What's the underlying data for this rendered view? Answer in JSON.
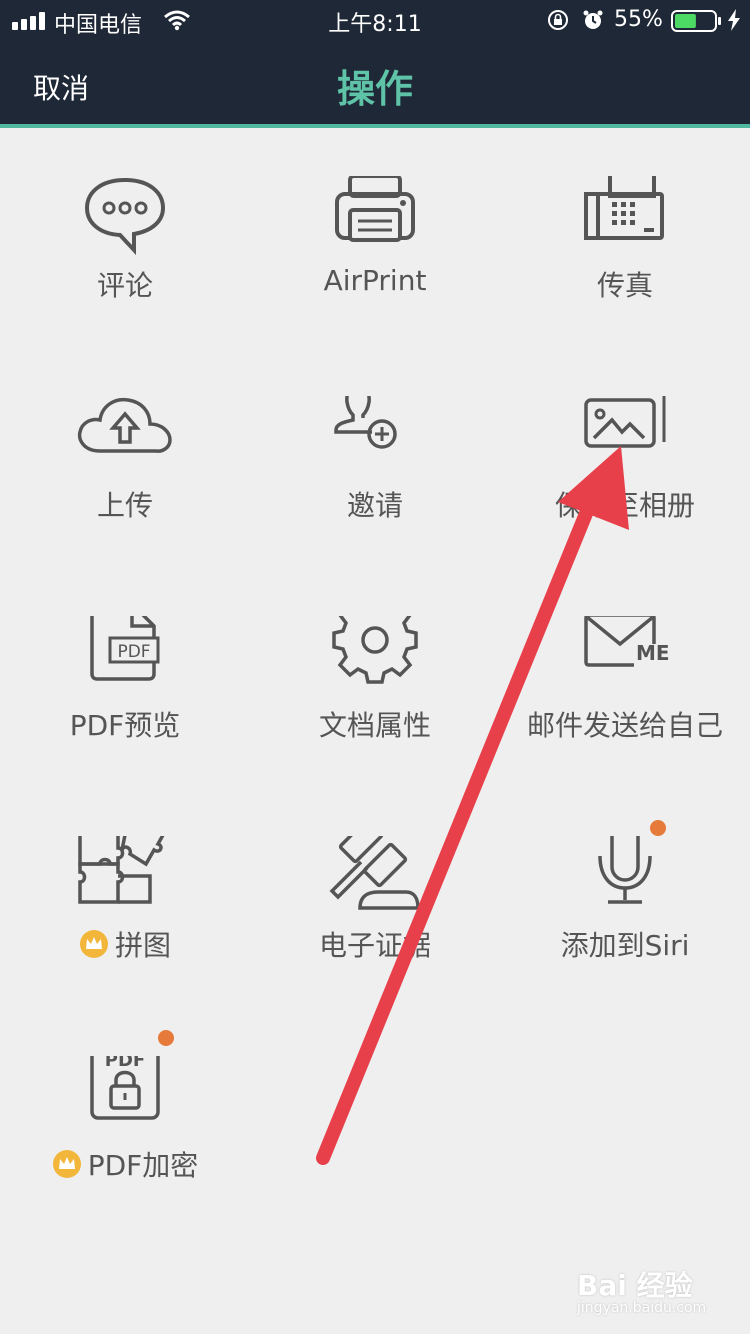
{
  "status_bar": {
    "carrier": "中国电信",
    "time": "上午8:11",
    "battery": "55%",
    "battery_level": 0.55
  },
  "nav": {
    "cancel": "取消",
    "title": "操作"
  },
  "actions": [
    {
      "label": "评论",
      "icon": "comment-icon"
    },
    {
      "label": "AirPrint",
      "icon": "printer-icon"
    },
    {
      "label": "传真",
      "icon": "fax-icon"
    },
    {
      "label": "上传",
      "icon": "cloud-upload-icon"
    },
    {
      "label": "邀请",
      "icon": "invite-user-icon"
    },
    {
      "label": "保存至相册",
      "icon": "photo-album-icon"
    },
    {
      "label": "PDF预览",
      "icon": "pdf-file-icon"
    },
    {
      "label": "文档属性",
      "icon": "gear-icon"
    },
    {
      "label": "邮件发送给自己",
      "icon": "mail-me-icon"
    },
    {
      "label": "拼图",
      "icon": "puzzle-icon",
      "premium": true
    },
    {
      "label": "电子证据",
      "icon": "gavel-icon"
    },
    {
      "label": "添加到Siri",
      "icon": "microphone-icon",
      "badge": true
    },
    {
      "label": "PDF加密",
      "icon": "pdf-lock-icon",
      "premium": true,
      "badge": true
    }
  ],
  "watermark": {
    "brand": "Bai  经验",
    "url": "jingyan.baidu.com"
  },
  "colors": {
    "header_bg": "#1f2837",
    "title": "#5ec3a7",
    "accent_line": "#4fb89e",
    "badge": "#e57a3a",
    "arrow": "#e8404a"
  }
}
